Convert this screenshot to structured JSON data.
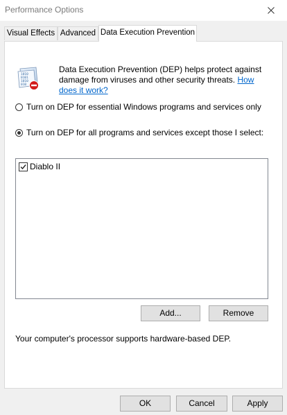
{
  "window": {
    "title": "Performance Options",
    "close_glyph": "✕"
  },
  "tabs": [
    {
      "label": "Visual Effects"
    },
    {
      "label": "Advanced"
    },
    {
      "label": "Data Execution Prevention",
      "active": true
    }
  ],
  "dep": {
    "icon": "dep-shield-binary-icon",
    "description": "Data Execution Prevention (DEP) helps protect against damage from viruses and other security threats.",
    "help_link": "How does it work?",
    "options": [
      {
        "label": "Turn on DEP for essential Windows programs and services only",
        "selected": false
      },
      {
        "label": "Turn on DEP for all programs and services except those I select:",
        "selected": true
      }
    ],
    "exceptions": [
      {
        "label": "Diablo II",
        "checked": true
      }
    ],
    "add_button": "Add...",
    "remove_button": "Remove",
    "status": "Your computer's processor supports hardware-based DEP."
  },
  "footer": {
    "ok": "OK",
    "cancel": "Cancel",
    "apply": "Apply"
  },
  "colors": {
    "link": "#0066cc",
    "window_bg": "#f0f0f0",
    "panel_bg": "#ffffff",
    "title_text": "#7a7a7a",
    "stop_red": "#d21c1c"
  }
}
